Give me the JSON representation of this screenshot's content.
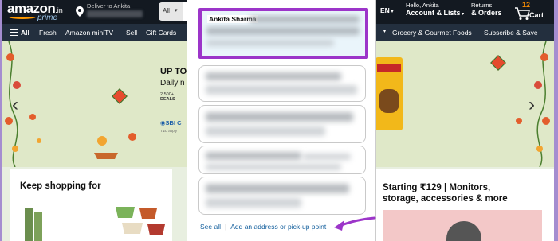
{
  "header": {
    "logo_text": "amazon",
    "logo_suffix": ".in",
    "logo_sub": "prime",
    "deliver_to": "Deliver to Ankita",
    "search_category": "All",
    "language": "EN",
    "account_greeting": "Hello, Ankita",
    "account_label": "Account & Lists",
    "returns_line1": "Returns",
    "returns_line2": "& Orders",
    "cart_count": "12",
    "cart_label": "Cart"
  },
  "nav": {
    "all": "All",
    "items": [
      "Fresh",
      "Amazon miniTV",
      "Sell",
      "Gift Cards",
      "Grocery & Gourmet Foods",
      "Subscribe & Save"
    ]
  },
  "hero": {
    "offer_title": "UP TO",
    "offer_sub": "Daily n",
    "deals_count": "2,500+",
    "deals_label": "DEALS",
    "bank": "SBI C",
    "bank_note": "T&C apply"
  },
  "cards": {
    "left_title": "Keep shopping for",
    "right_title_1": "Starting ₹129 | Monitors,",
    "right_title_2": "storage, accessories & more"
  },
  "modal": {
    "selected_name": "Ankita Sharma",
    "see_all": "See all",
    "separator": "|",
    "add_address": "Add an address or pick-up point"
  },
  "colors": {
    "highlight": "#9c35c9",
    "link": "#0f5c9b",
    "header_bg": "#131921",
    "nav_bg": "#232f3e",
    "accent": "#f90"
  }
}
